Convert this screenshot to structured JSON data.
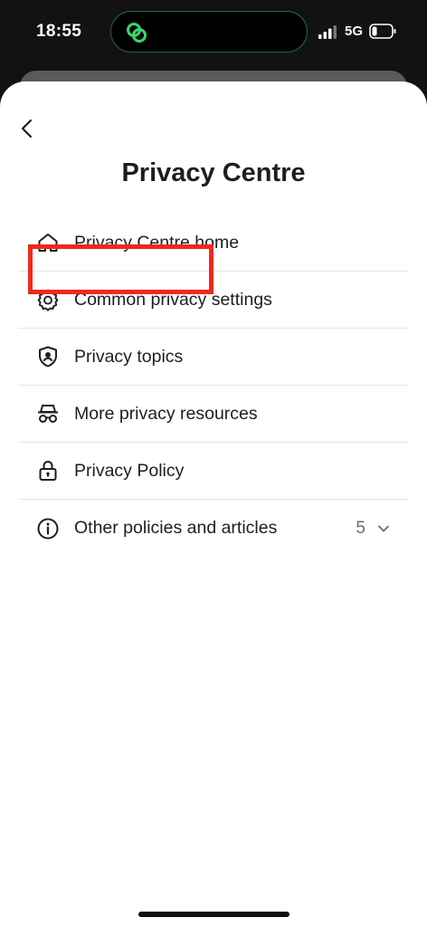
{
  "status_bar": {
    "time": "18:55",
    "network": "5G"
  },
  "page": {
    "title": "Privacy Centre"
  },
  "menu": {
    "items": [
      {
        "label": "Privacy Centre home",
        "icon": "home-icon"
      },
      {
        "label": "Common privacy settings",
        "icon": "gear-icon"
      },
      {
        "label": "Privacy topics",
        "icon": "shield-user-icon",
        "highlighted": true
      },
      {
        "label": "More privacy resources",
        "icon": "incognito-icon"
      },
      {
        "label": "Privacy Policy",
        "icon": "lock-icon"
      },
      {
        "label": "Other policies and articles",
        "icon": "info-icon",
        "count": "5"
      }
    ]
  },
  "colors": {
    "highlight": "#f0291b",
    "text": "#1c1e21",
    "island_accent": "#35d96a"
  }
}
